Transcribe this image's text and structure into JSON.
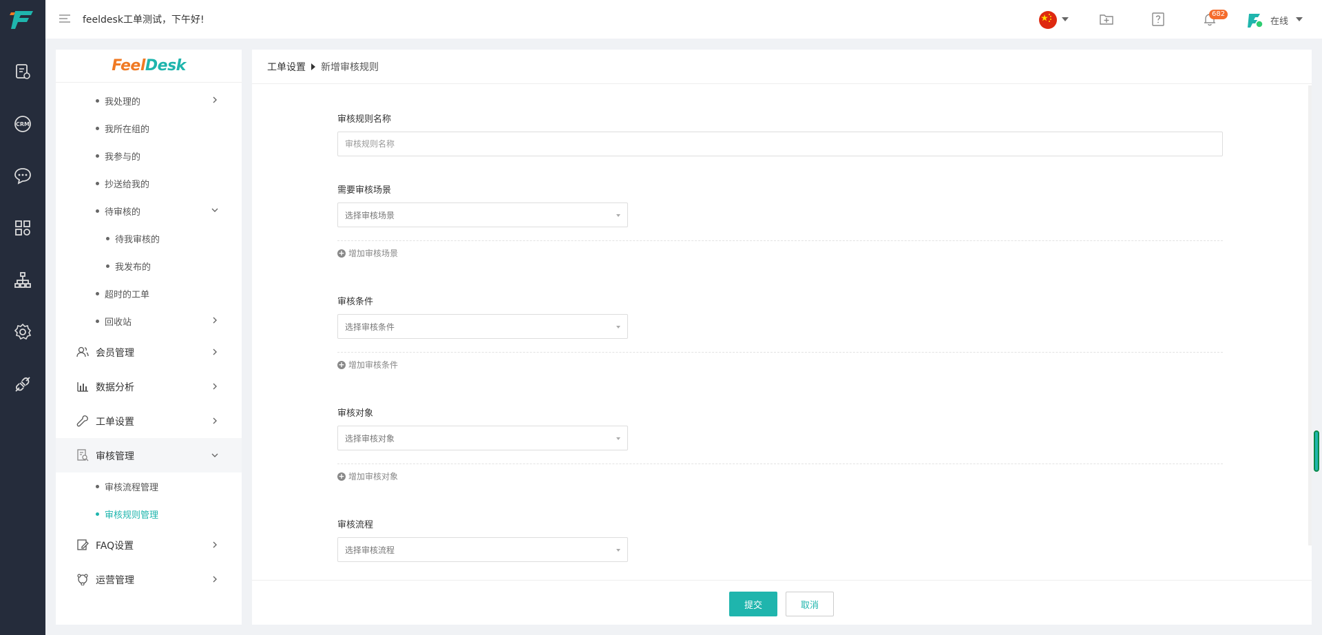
{
  "header": {
    "greeting": "feeldesk工单测试，下午好!",
    "notification_count": "682",
    "status": "在线"
  },
  "brand": {
    "logo_prefix": "Feel",
    "logo_suffix": "Desk",
    "accent": "#1fb5ad",
    "logo_orange": "#f07a24"
  },
  "rail": {
    "icons": [
      "ticket-settings-icon",
      "crm-icon",
      "chat-icon",
      "apps-icon",
      "org-chart-icon",
      "settings-icon",
      "plugin-icon"
    ]
  },
  "sidebar": {
    "sub_items_top": [
      {
        "label": "我处理的",
        "has_chevron": "right"
      },
      {
        "label": "我所在组的"
      },
      {
        "label": "我参与的"
      },
      {
        "label": "抄送给我的"
      },
      {
        "label": "待审核的",
        "has_chevron": "down"
      },
      {
        "label": "待我审核的",
        "nested": true
      },
      {
        "label": "我发布的",
        "nested": true
      },
      {
        "label": "超时的工单"
      },
      {
        "label": "回收站",
        "has_chevron": "right"
      }
    ],
    "groups": [
      {
        "label": "会员管理"
      },
      {
        "label": "数据分析"
      },
      {
        "label": "工单设置"
      },
      {
        "label": "审核管理",
        "open": true
      },
      {
        "label": "FAQ设置"
      },
      {
        "label": "运营管理"
      }
    ],
    "audit_sub_items": [
      {
        "label": "审核流程管理"
      },
      {
        "label": "审核规则管理",
        "active": true
      }
    ]
  },
  "breadcrumb": {
    "parent": "工单设置",
    "current": "新增审核规则"
  },
  "form": {
    "rule_name": {
      "label": "审核规则名称",
      "placeholder": "审核规则名称"
    },
    "scene": {
      "label": "需要审核场景",
      "placeholder": "选择审核场景",
      "add_label": "增加审核场景"
    },
    "condition": {
      "label": "审核条件",
      "placeholder": "选择审核条件",
      "add_label": "增加审核条件"
    },
    "target": {
      "label": "审核对象",
      "placeholder": "选择审核对象",
      "add_label": "增加审核对象"
    },
    "flow": {
      "label": "审核流程",
      "placeholder": "选择审核流程"
    }
  },
  "actions": {
    "submit": "提交",
    "cancel": "取消"
  }
}
